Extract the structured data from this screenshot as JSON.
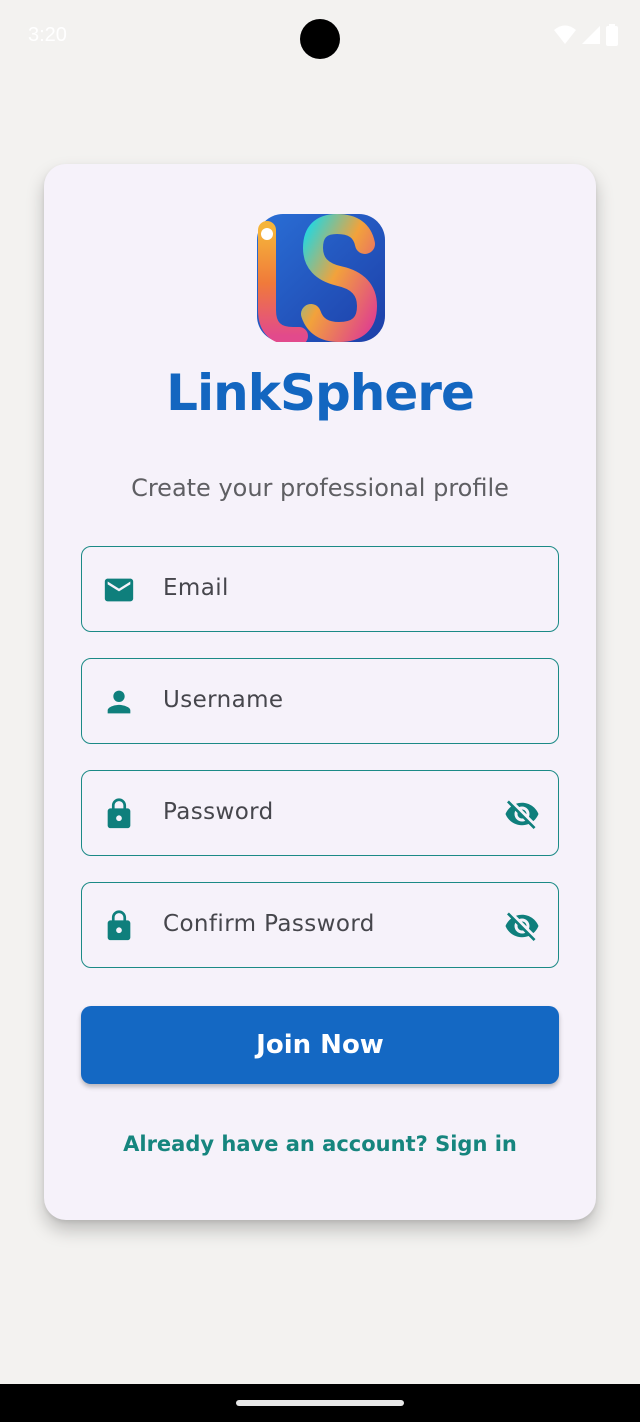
{
  "status_bar": {
    "time": "3:20",
    "icons": [
      "wifi-icon",
      "cellular-signal-icon",
      "battery-icon"
    ]
  },
  "app": {
    "name": "LinkSphere",
    "logo_letters": "LS",
    "subtitle": "Create your professional profile"
  },
  "form": {
    "fields": [
      {
        "label": "Email",
        "icon": "email-icon",
        "trailing_icon": null
      },
      {
        "label": "Username",
        "icon": "person-icon",
        "trailing_icon": null
      },
      {
        "label": "Password",
        "icon": "lock-icon",
        "trailing_icon": "visibility-off-icon"
      },
      {
        "label": "Confirm Password",
        "icon": "lock-icon",
        "trailing_icon": "visibility-off-icon"
      }
    ],
    "submit_label": "Join Now",
    "signin_text": "Already have an account? Sign in"
  },
  "colors": {
    "brand_blue": "#1468c3",
    "accent_teal": "#16857e",
    "card_background": "#f6f2fa",
    "page_background": "#f3f2f0"
  }
}
